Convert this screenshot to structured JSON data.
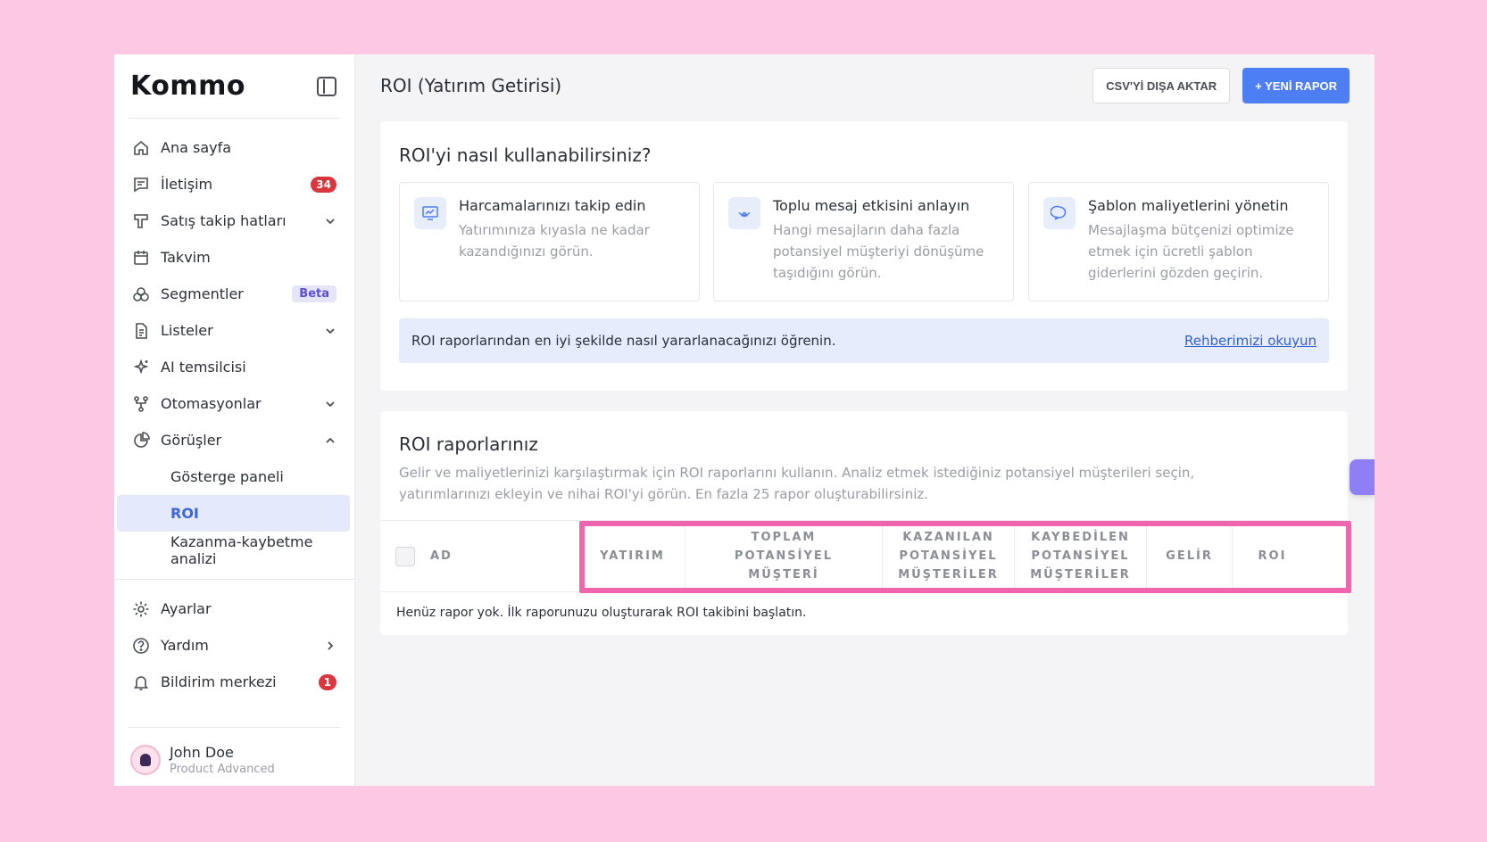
{
  "brand": {
    "logo": "Kommo"
  },
  "sidebar": {
    "items": [
      {
        "label": "Ana sayfa"
      },
      {
        "label": "İletişim",
        "badge": "34"
      },
      {
        "label": "Satış takip hatları"
      },
      {
        "label": "Takvim"
      },
      {
        "label": "Segmentler",
        "badge": "Beta"
      },
      {
        "label": "Listeler"
      },
      {
        "label": "AI temsilcisi"
      },
      {
        "label": "Otomasyonlar"
      },
      {
        "label": "Görüşler"
      }
    ],
    "subitems": [
      {
        "label": "Gösterge paneli"
      },
      {
        "label": "ROI"
      },
      {
        "label": "Kazanma-kaybetme analizi"
      }
    ],
    "bottom": [
      {
        "label": "Ayarlar"
      },
      {
        "label": "Yardım"
      },
      {
        "label": "Bildirim merkezi",
        "badge": "1"
      }
    ],
    "user": {
      "name": "John Doe",
      "plan": "Product Advanced"
    }
  },
  "header": {
    "title": "ROI (Yatırım Getirisi)",
    "export_label": "CSV'Yİ DIŞA AKTAR",
    "new_report_label": "+ YENİ RAPOR"
  },
  "howto": {
    "title": "ROI'yi nasıl kullanabilirsiniz?",
    "tips": [
      {
        "title": "Harcamalarınızı takip edin",
        "desc": "Yatırımınıza kıyasla ne kadar kazandığınızı görün."
      },
      {
        "title": "Toplu mesaj etkisini anlayın",
        "desc": "Hangi mesajların daha fazla potansiyel müşteriyi dönüşüme taşıdığını görün."
      },
      {
        "title": "Şablon maliyetlerini yönetin",
        "desc": "Mesajlaşma bütçenizi optimize etmek için ücretli şablon giderlerini gözden geçirin."
      }
    ],
    "guide_text": "ROI raporlarından en iyi şekilde nasıl yararlanacağınızı öğrenin.",
    "guide_link": "Rehberimizi okuyun"
  },
  "reports": {
    "title": "ROI raporlarınız",
    "desc": "Gelir ve maliyetlerinizi karşılaştırmak için ROI raporlarını kullanın. Analiz etmek istediğiniz potansiyel müşterileri seçin, yatırımlarınızı ekleyin ve nihai ROI'yi görün. En fazla 25 rapor oluşturabilirsiniz.",
    "columns": [
      "AD",
      "YATIRIM",
      "TOPLAM POTANSİYEL MÜŞTERİ",
      "KAZANILAN POTANSİYEL MÜŞTERİLER",
      "KAYBEDİLEN POTANSİYEL MÜŞTERİLER",
      "GELİR",
      "ROI"
    ],
    "empty": "Henüz rapor yok. İlk raporunuzu oluşturarak ROI takibini başlatın."
  },
  "colors": {
    "accent": "#4d7ef3",
    "highlight": "#ef66ae",
    "background": "#fcc8e3",
    "badge": "#d9363e"
  }
}
